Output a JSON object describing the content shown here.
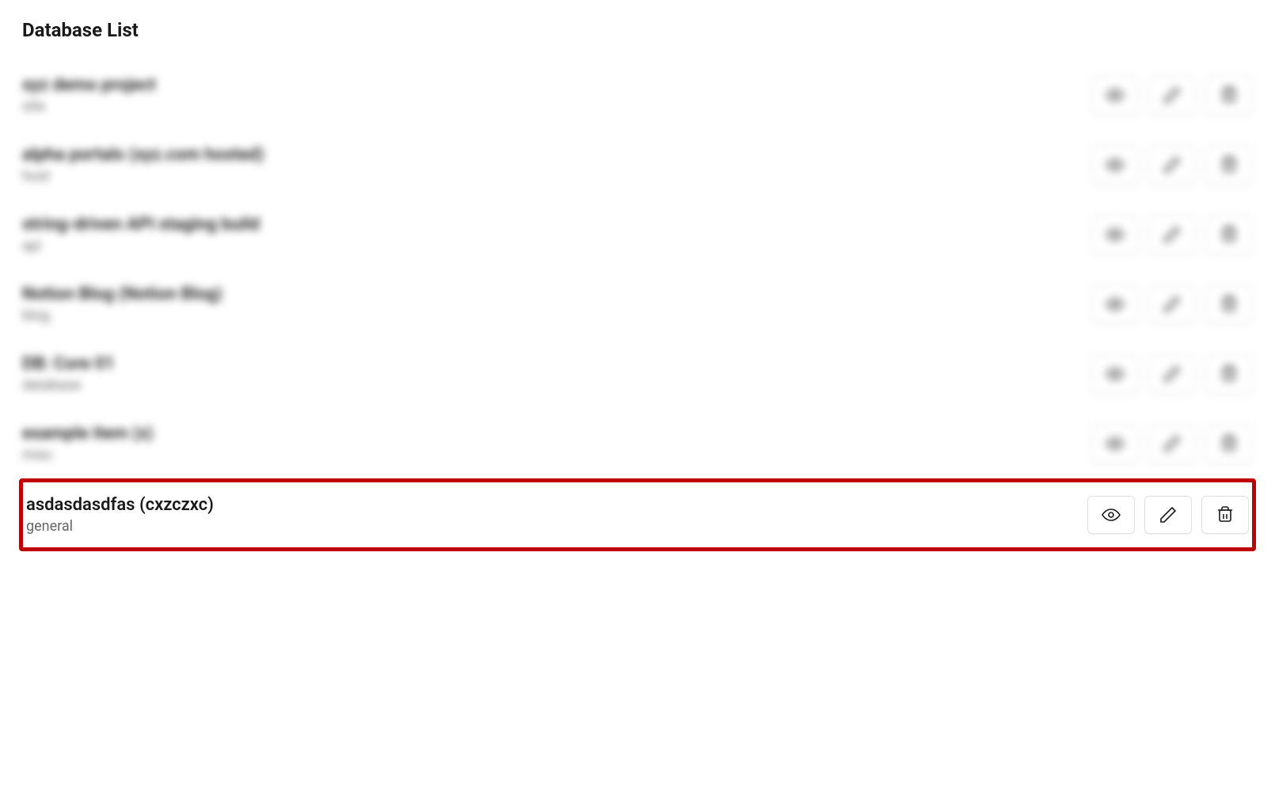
{
  "page": {
    "title": "Database List"
  },
  "items": [
    {
      "title": "xyz demo project",
      "subtitle": "site",
      "blurred": true,
      "highlighted": false
    },
    {
      "title": "alpha portals (xyz.com hosted)",
      "subtitle": "host",
      "blurred": true,
      "highlighted": false
    },
    {
      "title": "string-driven API staging build",
      "subtitle": "api",
      "blurred": true,
      "highlighted": false
    },
    {
      "title": "Notion Blog (Notion Blog)",
      "subtitle": "blog",
      "blurred": true,
      "highlighted": false
    },
    {
      "title": "DB: Core 01",
      "subtitle": "database",
      "blurred": true,
      "highlighted": false
    },
    {
      "title": "example item (x)",
      "subtitle": "misc",
      "blurred": true,
      "highlighted": false
    },
    {
      "title": "asdasdasdfas (cxzczxc)",
      "subtitle": "general",
      "blurred": false,
      "highlighted": true
    }
  ],
  "icons": {
    "view": "view",
    "edit": "edit",
    "delete": "delete"
  }
}
